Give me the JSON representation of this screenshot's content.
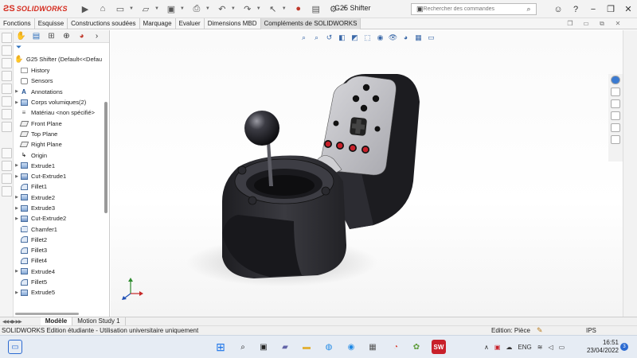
{
  "app": {
    "brand": "SOLIDWORKS",
    "document_title": "G25 Shifter"
  },
  "search": {
    "placeholder": "Rechercher des commandes"
  },
  "command_tabs": [
    "Fonctions",
    "Esquisse",
    "Constructions soudées",
    "Marquage",
    "Evaluer",
    "Dimensions MBD",
    "Compléments de SOLIDWORKS"
  ],
  "feature_tree": {
    "root": "G25 Shifter  (Default<<Defau",
    "items": [
      {
        "label": "History",
        "icon": "history-icon",
        "expandable": false
      },
      {
        "label": "Sensors",
        "icon": "sensors-icon",
        "expandable": false
      },
      {
        "label": "Annotations",
        "icon": "annotations-icon",
        "expandable": true
      },
      {
        "label": "Corps volumiques(2)",
        "icon": "solid-bodies-icon",
        "expandable": true
      },
      {
        "label": "Matériau <non spécifié>",
        "icon": "material-icon",
        "expandable": false
      },
      {
        "label": "Front Plane",
        "icon": "plane-icon",
        "expandable": false
      },
      {
        "label": "Top Plane",
        "icon": "plane-icon",
        "expandable": false
      },
      {
        "label": "Right Plane",
        "icon": "plane-icon",
        "expandable": false
      },
      {
        "label": "Origin",
        "icon": "origin-icon",
        "expandable": false
      },
      {
        "label": "Extrude1",
        "icon": "extrude-icon",
        "expandable": true
      },
      {
        "label": "Cut-Extrude1",
        "icon": "cut-extrude-icon",
        "expandable": true
      },
      {
        "label": "Fillet1",
        "icon": "fillet-icon",
        "expandable": false
      },
      {
        "label": "Extrude2",
        "icon": "extrude-icon",
        "expandable": true
      },
      {
        "label": "Extrude3",
        "icon": "extrude-icon",
        "expandable": true
      },
      {
        "label": "Cut-Extrude2",
        "icon": "cut-extrude-icon",
        "expandable": true
      },
      {
        "label": "Chamfer1",
        "icon": "chamfer-icon",
        "expandable": false
      },
      {
        "label": "Fillet2",
        "icon": "fillet-icon",
        "expandable": false
      },
      {
        "label": "Fillet3",
        "icon": "fillet-icon",
        "expandable": false
      },
      {
        "label": "Fillet4",
        "icon": "fillet-icon",
        "expandable": false
      },
      {
        "label": "Extrude4",
        "icon": "extrude-icon",
        "expandable": true
      },
      {
        "label": "Fillet5",
        "icon": "fillet-icon",
        "expandable": false
      },
      {
        "label": "Extrude5",
        "icon": "extrude-icon",
        "expandable": true
      }
    ]
  },
  "model_tabs": [
    "Modèle",
    "Motion Study 1"
  ],
  "status": {
    "license": "SOLIDWORKS Edition étudiante - Utilisation universitaire uniquement",
    "editing": "Edition: Pièce",
    "units": "IPS"
  },
  "tray": {
    "language": "ENG",
    "time": "16:51",
    "date": "23/04/2022",
    "notifications": "3"
  },
  "colors": {
    "brand_red": "#d52b1e",
    "accent_blue": "#2a6ebb",
    "model_body": "#2b2b30",
    "button_red": "#c8202a"
  }
}
